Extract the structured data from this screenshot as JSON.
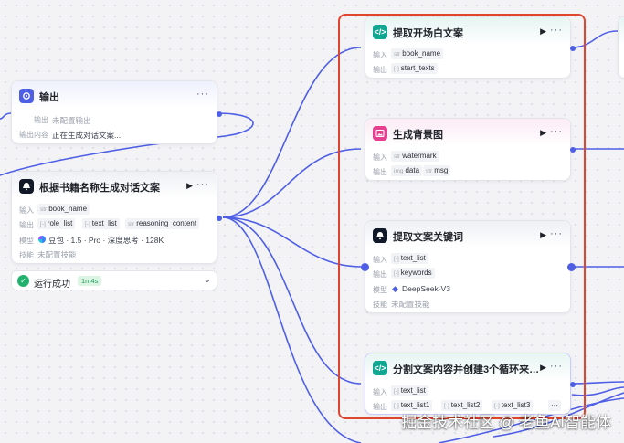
{
  "colors": {
    "accent": "#4e5fe6",
    "selection": "#e0452f",
    "success": "#23b26d"
  },
  "labels": {
    "input": "输入",
    "output": "输出",
    "model": "模型",
    "skill": "技能",
    "output_content": "输出内容"
  },
  "nodes": {
    "output": {
      "title": "输出",
      "icon": "output-node-icon",
      "output_value": "未配置输出",
      "content_value": "正在生成对话文案..."
    },
    "dialogue": {
      "title": "根据书籍名称生成对话文案",
      "icon": "llm-node-icon",
      "input": {
        "type": "str",
        "name": "book_name"
      },
      "outputs": [
        {
          "type": "[-]",
          "name": "role_list"
        },
        {
          "type": "[-]",
          "name": "text_list"
        },
        {
          "type": "str",
          "name": "reasoning_content"
        }
      ],
      "model": "豆包 · 1.5 · Pro · 深度思考 · 128K",
      "skill": "未配置技能"
    },
    "extract_opening": {
      "title": "提取开场白文案",
      "icon": "code-node-icon",
      "input": {
        "type": "str",
        "name": "book_name"
      },
      "output": {
        "type": "[-]",
        "name": "start_texts"
      }
    },
    "background": {
      "title": "生成背景图",
      "icon": "image-node-icon",
      "input": {
        "type": "str",
        "name": "watermark"
      },
      "outputs": [
        {
          "type": "img",
          "name": "data"
        },
        {
          "type": "str",
          "name": "msg"
        }
      ]
    },
    "keywords": {
      "title": "提取文案关键词",
      "icon": "llm-node-icon",
      "input": {
        "type": "[-]",
        "name": "text_list"
      },
      "output": {
        "type": "[-]",
        "name": "keywords"
      },
      "model": "DeepSeek-V3",
      "skill": "未配置技能"
    },
    "split": {
      "title": "分割文案内容并创建3个循环来…",
      "icon": "code-node-icon",
      "input": {
        "type": "[-]",
        "name": "text_list"
      },
      "outputs": [
        {
          "type": "[-]",
          "name": "text_list1"
        },
        {
          "type": "[-]",
          "name": "text_list2"
        },
        {
          "type": "[-]",
          "name": "text_list3"
        }
      ],
      "more": "···"
    }
  },
  "status": {
    "text": "运行成功",
    "duration": "1m4s"
  },
  "watermark": "掘金技术社区 @ 老鱼AI智能体"
}
